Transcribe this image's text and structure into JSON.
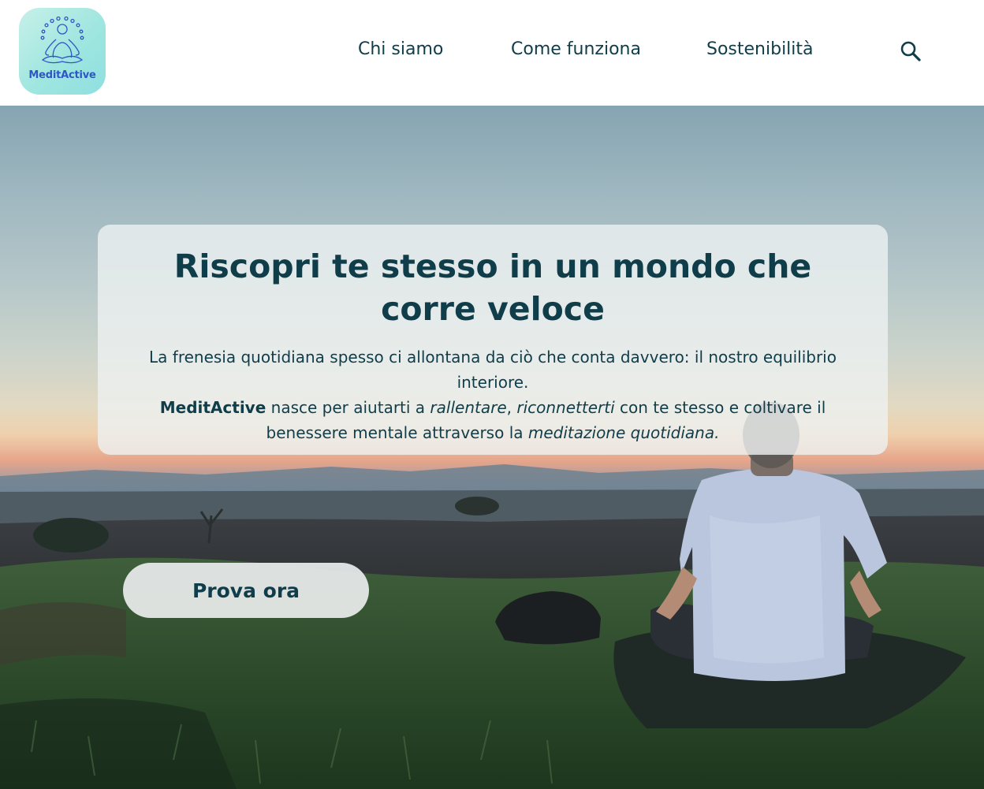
{
  "brand": {
    "name": "MeditActive",
    "logo_icon": "meditation-icon",
    "colors": {
      "primary": "#0f3d4a",
      "logo_text": "#2f56c4",
      "logo_bg": "#a8e8e0"
    }
  },
  "nav": {
    "items": [
      {
        "label": "Chi siamo"
      },
      {
        "label": "Come funziona"
      },
      {
        "label": "Sostenibilità"
      }
    ],
    "search_icon": "search-icon"
  },
  "hero": {
    "title": "Riscopri te stesso in un mondo che corre veloce",
    "intro": "La frenesia quotidiana spesso ci allontana da ciò che conta davvero: il nostro equilibrio interiore.",
    "brand_strong": "MeditActive",
    "text_1": " nasce per aiutarti a ",
    "em_1": "rallentare",
    "text_2": ", ",
    "em_2": "riconnetterti",
    "text_3": " con te stesso e coltivare il benessere mentale attraverso la ",
    "em_3": "meditazione quotidiana.",
    "cta_label": "Prova ora"
  }
}
